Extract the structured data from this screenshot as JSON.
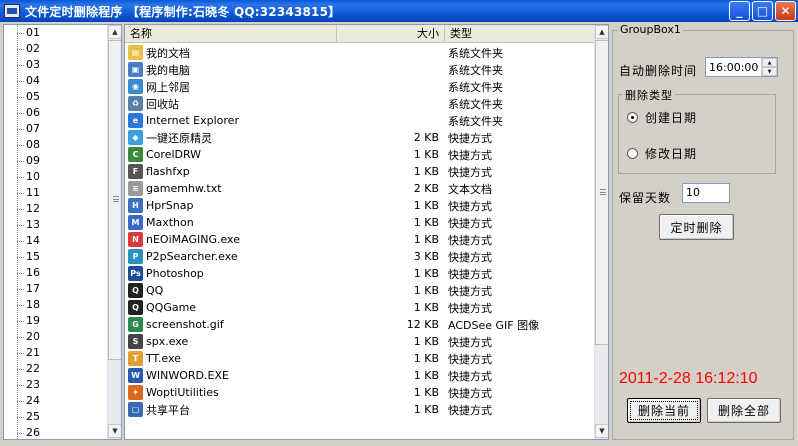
{
  "window": {
    "title": "文件定时删除程序 【程序制作:石晓冬 QQ:32343815】",
    "buttons": {
      "minimize": "_",
      "maximize": "□",
      "close": "✕"
    }
  },
  "tree": {
    "items": [
      "01",
      "02",
      "03",
      "04",
      "05",
      "06",
      "07",
      "08",
      "09",
      "10",
      "11",
      "12",
      "13",
      "14",
      "15",
      "16",
      "17",
      "18",
      "19",
      "20",
      "21",
      "22",
      "23",
      "24",
      "25",
      "26"
    ]
  },
  "file_list": {
    "columns": {
      "name": "名称",
      "size": "大小",
      "type": "类型"
    },
    "rows": [
      {
        "name": "我的文档",
        "size": "",
        "type": "系统文件夹",
        "icon": "my-documents-icon",
        "icon_color": "#e8c048",
        "glyph": "▤"
      },
      {
        "name": "我的电脑",
        "size": "",
        "type": "系统文件夹",
        "icon": "my-computer-icon",
        "icon_color": "#4a7fc8",
        "glyph": "▣"
      },
      {
        "name": "网上邻居",
        "size": "",
        "type": "系统文件夹",
        "icon": "network-icon",
        "icon_color": "#3a8ad0",
        "glyph": "◉"
      },
      {
        "name": "回收站",
        "size": "",
        "type": "系统文件夹",
        "icon": "recycle-bin-icon",
        "icon_color": "#5a7fa8",
        "glyph": "♻"
      },
      {
        "name": "Internet Explorer",
        "size": "",
        "type": "系统文件夹",
        "icon": "ie-icon",
        "icon_color": "#2a78d8",
        "glyph": "e"
      },
      {
        "name": "一键还原精灵",
        "size": "2 KB",
        "type": "快捷方式",
        "icon": "restore-icon",
        "icon_color": "#3aa0e0",
        "glyph": "◆"
      },
      {
        "name": "CorelDRW",
        "size": "1 KB",
        "type": "快捷方式",
        "icon": "coreldraw-icon",
        "icon_color": "#3a8a3a",
        "glyph": "C"
      },
      {
        "name": "flashfxp",
        "size": "1 KB",
        "type": "快捷方式",
        "icon": "flashfxp-icon",
        "icon_color": "#555555",
        "glyph": "F"
      },
      {
        "name": "gamemhw.txt",
        "size": "2 KB",
        "type": "文本文档",
        "icon": "text-file-icon",
        "icon_color": "#9a9a9a",
        "glyph": "≡"
      },
      {
        "name": "HprSnap",
        "size": "1 KB",
        "type": "快捷方式",
        "icon": "hprsnap-icon",
        "icon_color": "#3a70c0",
        "glyph": "H"
      },
      {
        "name": "Maxthon",
        "size": "1 KB",
        "type": "快捷方式",
        "icon": "maxthon-icon",
        "icon_color": "#3a6ac8",
        "glyph": "M"
      },
      {
        "name": "nEOiMAGING.exe",
        "size": "1 KB",
        "type": "快捷方式",
        "icon": "neoimaging-icon",
        "icon_color": "#d83a3a",
        "glyph": "N"
      },
      {
        "name": "P2pSearcher.exe",
        "size": "3 KB",
        "type": "快捷方式",
        "icon": "p2psearcher-icon",
        "icon_color": "#2a90c0",
        "glyph": "P"
      },
      {
        "name": "Photoshop",
        "size": "1 KB",
        "type": "快捷方式",
        "icon": "photoshop-icon",
        "icon_color": "#1e4e9a",
        "glyph": "Ps"
      },
      {
        "name": "QQ",
        "size": "1 KB",
        "type": "快捷方式",
        "icon": "qq-penguin-icon",
        "icon_color": "#222222",
        "glyph": "Q"
      },
      {
        "name": "QQGame",
        "size": "1 KB",
        "type": "快捷方式",
        "icon": "qqgame-icon",
        "icon_color": "#222222",
        "glyph": "Q"
      },
      {
        "name": "screenshot.gif",
        "size": "12 KB",
        "type": "ACDSee GIF 图像",
        "icon": "gif-image-icon",
        "icon_color": "#2a8a4a",
        "glyph": "G"
      },
      {
        "name": "spx.exe",
        "size": "1 KB",
        "type": "快捷方式",
        "icon": "spx-icon",
        "icon_color": "#444444",
        "glyph": "S"
      },
      {
        "name": "TT.exe",
        "size": "1 KB",
        "type": "快捷方式",
        "icon": "tt-icon",
        "icon_color": "#e0a030",
        "glyph": "T"
      },
      {
        "name": "WINWORD.EXE",
        "size": "1 KB",
        "type": "快捷方式",
        "icon": "word-icon",
        "icon_color": "#2a5ab0",
        "glyph": "W"
      },
      {
        "name": "WoptiUtilities",
        "size": "1 KB",
        "type": "快捷方式",
        "icon": "wopti-icon",
        "icon_color": "#d86a1a",
        "glyph": "✦"
      },
      {
        "name": "共享平台",
        "size": "1 KB",
        "type": "快捷方式",
        "icon": "share-platform-icon",
        "icon_color": "#3a6ab0",
        "glyph": "▢"
      }
    ]
  },
  "groupbox1": {
    "title": "GroupBox1",
    "auto_delete_label": "自动删除时间",
    "auto_delete_time": "16:00:00",
    "delete_type": {
      "title": "删除类型",
      "options": [
        "创建日期",
        "修改日期"
      ],
      "selected": "创建日期"
    },
    "keep_days_label": "保留天数",
    "keep_days_value": "10",
    "timed_delete_button": "定时删除",
    "clock": "2011-2-28 16:12:10",
    "delete_current_button": "删除当前",
    "delete_all_button": "删除全部"
  }
}
